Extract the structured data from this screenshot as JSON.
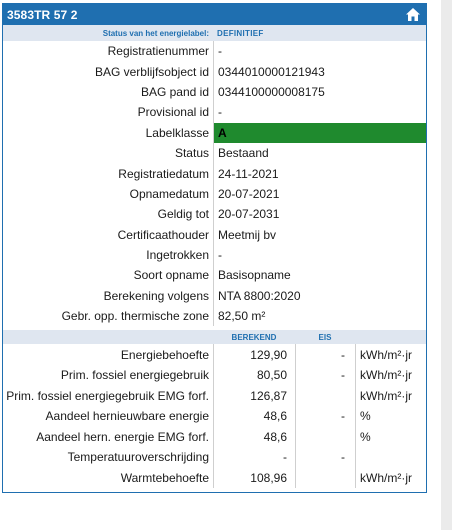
{
  "header": {
    "title": "3583TR 57 2",
    "home_icon": "home-icon"
  },
  "status": {
    "label": "Status van het energielabel:",
    "value": "DEFINITIEF"
  },
  "fields": [
    {
      "label": "Registratienummer",
      "value": "-"
    },
    {
      "label": "BAG verblijfsobject id",
      "value": "0344010000121943"
    },
    {
      "label": "BAG pand id",
      "value": "0344100000008175"
    },
    {
      "label": "Provisional id",
      "value": "-"
    },
    {
      "label": "Labelklasse",
      "value": "A"
    },
    {
      "label": "Status",
      "value": "Bestaand"
    },
    {
      "label": "Registratiedatum",
      "value": "24-11-2021"
    },
    {
      "label": "Opnamedatum",
      "value": "20-07-2021"
    },
    {
      "label": "Geldig tot",
      "value": "20-07-2031"
    },
    {
      "label": "Certificaathouder",
      "value": "Meetmij bv"
    },
    {
      "label": "Ingetrokken",
      "value": "-"
    },
    {
      "label": "Soort opname",
      "value": "Basisopname"
    },
    {
      "label": "Berekening volgens",
      "value": "NTA 8800:2020"
    },
    {
      "label": "Gebr. opp. thermische zone",
      "value": "82,50 m²"
    }
  ],
  "label_class_color": "#1f8a2e",
  "table": {
    "headers": {
      "berekend": "BEREKEND",
      "eis": "EIS"
    },
    "rows": [
      {
        "label": "Energiebehoefte",
        "berekend": "129,90",
        "eis": "-",
        "unit": "kWh/m²·jr"
      },
      {
        "label": "Prim. fossiel energiegebruik",
        "berekend": "80,50",
        "eis": "-",
        "unit": "kWh/m²·jr"
      },
      {
        "label": "Prim. fossiel energiegebruik EMG forf.",
        "berekend": "126,87",
        "eis": "",
        "unit": "kWh/m²·jr"
      },
      {
        "label": "Aandeel hernieuwbare energie",
        "berekend": "48,6",
        "eis": "-",
        "unit": "%"
      },
      {
        "label": "Aandeel hern. energie EMG forf.",
        "berekend": "48,6",
        "eis": "",
        "unit": "%"
      },
      {
        "label": "Temperatuuroverschrijding",
        "berekend": "-",
        "eis": "-",
        "unit": ""
      },
      {
        "label": "Warmtebehoefte",
        "berekend": "108,96",
        "eis": "",
        "unit": "kWh/m²·jr"
      }
    ]
  },
  "colors": {
    "accent": "#1f6fb0",
    "band": "#dfe6f0",
    "label_green": "#1f8a2e"
  }
}
